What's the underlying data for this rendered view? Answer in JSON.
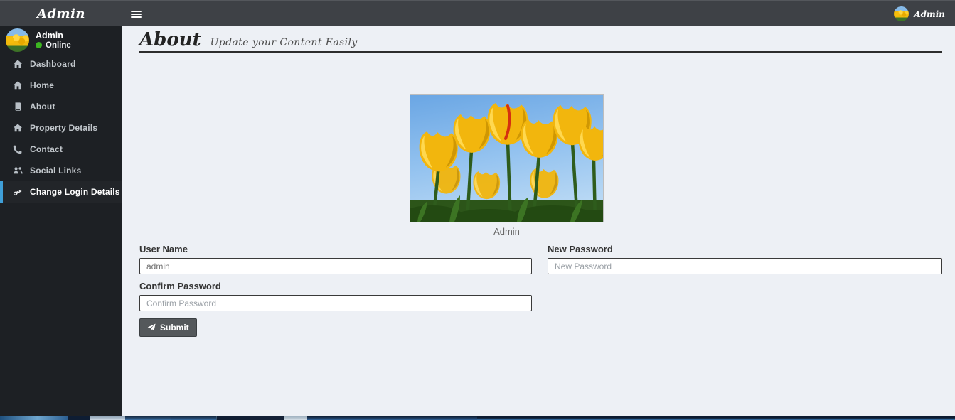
{
  "navbar": {
    "brand": "Admin",
    "user_menu": {
      "label": "Admin"
    }
  },
  "sidebar": {
    "user": {
      "name": "Admin",
      "status": "Online"
    },
    "items": [
      {
        "label": "Dashboard",
        "icon": "home-icon",
        "active": false
      },
      {
        "label": "Home",
        "icon": "home-icon",
        "active": false
      },
      {
        "label": "About",
        "icon": "book-icon",
        "active": false
      },
      {
        "label": "Property Details",
        "icon": "home-icon",
        "active": false
      },
      {
        "label": "Contact",
        "icon": "phone-icon",
        "active": false
      },
      {
        "label": "Social Links",
        "icon": "users-icon",
        "active": false
      },
      {
        "label": "Change Login Details",
        "icon": "key-icon",
        "active": true
      }
    ]
  },
  "content": {
    "header": {
      "title": "About",
      "subtitle": "Update your Content Easily"
    },
    "image": {
      "caption": "Admin"
    },
    "form": {
      "username": {
        "label": "User Name",
        "value": "admin"
      },
      "new_password": {
        "label": "New Password",
        "placeholder": "New Password"
      },
      "confirm_password": {
        "label": "Confirm Password",
        "placeholder": "Confirm Password"
      },
      "submit_label": "Submit"
    }
  },
  "colors": {
    "navbar_bg": "#3e4146",
    "sidebar_bg": "#1d2024",
    "content_bg": "#edf0f5",
    "active_accent": "#3f9fd8",
    "online_dot": "#3cb521",
    "submit_bg": "#54585b"
  }
}
